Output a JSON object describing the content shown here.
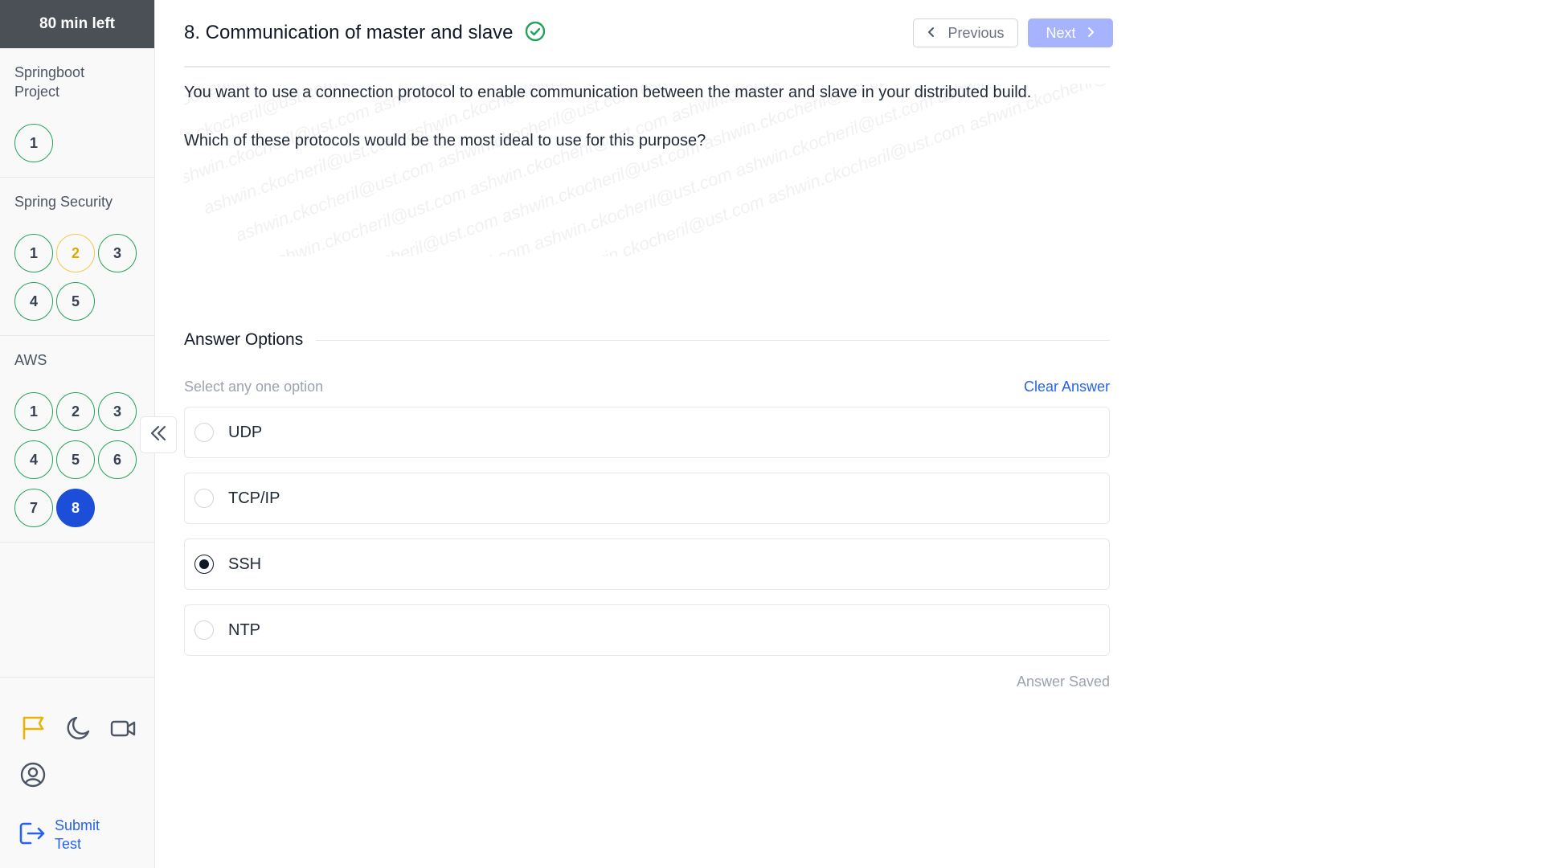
{
  "timer": {
    "text": "80 min left"
  },
  "sidebar": {
    "sections": [
      {
        "title": "Springboot Project",
        "questions": [
          {
            "label": "1",
            "state": "answered"
          }
        ]
      },
      {
        "title": "Spring Security",
        "questions": [
          {
            "label": "1",
            "state": "answered"
          },
          {
            "label": "2",
            "state": "review"
          },
          {
            "label": "3",
            "state": "answered"
          },
          {
            "label": "4",
            "state": "answered"
          },
          {
            "label": "5",
            "state": "answered"
          }
        ]
      },
      {
        "title": "AWS",
        "questions": [
          {
            "label": "1",
            "state": "answered"
          },
          {
            "label": "2",
            "state": "answered"
          },
          {
            "label": "3",
            "state": "answered"
          },
          {
            "label": "4",
            "state": "answered"
          },
          {
            "label": "5",
            "state": "answered"
          },
          {
            "label": "6",
            "state": "answered"
          },
          {
            "label": "7",
            "state": "answered"
          },
          {
            "label": "8",
            "state": "current"
          }
        ]
      }
    ],
    "tools": [
      "flag-icon",
      "moon-icon",
      "video-camera-icon",
      "user-circle-icon"
    ],
    "submit_label": "Submit Test"
  },
  "header": {
    "title": "8. Communication of master and slave",
    "prev_label": "Previous",
    "next_label": "Next"
  },
  "question": {
    "paragraph1": "You want to use a connection protocol to enable communication between the master and slave in your distributed build.",
    "paragraph2": "Which of these protocols would be the most ideal to use for this purpose?",
    "watermark": "ashwin.ckocheril@ust.com"
  },
  "answers": {
    "heading": "Answer Options",
    "hint": "Select any one option",
    "clear_label": "Clear Answer",
    "options": [
      {
        "label": "UDP",
        "selected": false
      },
      {
        "label": "TCP/IP",
        "selected": false
      },
      {
        "label": "SSH",
        "selected": true
      },
      {
        "label": "NTP",
        "selected": false
      }
    ],
    "status": "Answer Saved"
  },
  "colors": {
    "accent": "#2563eb",
    "answered": "#22a35a",
    "review": "#f2c94c",
    "current": "#1d4ed8",
    "next_disabled": "#a5b4fc",
    "flag": "#eab308"
  }
}
